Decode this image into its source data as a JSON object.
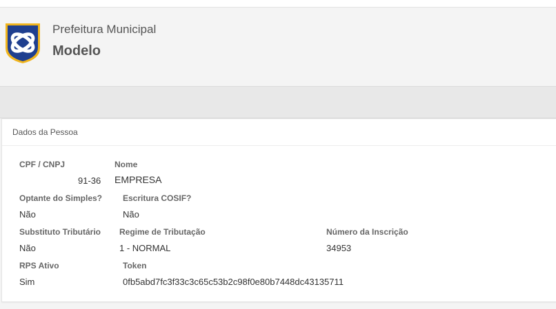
{
  "header": {
    "org_line1": "Prefeitura Municipal",
    "org_line2": "Modelo"
  },
  "colors": {
    "logo_blue": "#1f3f8f",
    "logo_gold": "#f0b41c"
  },
  "panel": {
    "title": "Dados da Pessoa",
    "fields": {
      "cpf_cnpj": {
        "label": "CPF / CNPJ",
        "value": "91-36"
      },
      "nome": {
        "label": "Nome",
        "value": "EMPRESA"
      },
      "optante_simples": {
        "label": "Optante do Simples?",
        "value": "Não"
      },
      "escritura_cosif": {
        "label": "Escritura COSIF?",
        "value": "Não"
      },
      "substituto_tributario": {
        "label": "Substituto Tributário",
        "value": "Não"
      },
      "regime_tributacao": {
        "label": "Regime de Tributação",
        "value": "1 - NORMAL"
      },
      "numero_inscricao": {
        "label": "Número da Inscrição",
        "value": "34953"
      },
      "rps_ativo": {
        "label": "RPS Ativo",
        "value": "Sim"
      },
      "token": {
        "label": "Token",
        "value": "0fb5abd7fc3f33c3c65c53b2c98f0e80b7448dc43135711"
      }
    }
  }
}
